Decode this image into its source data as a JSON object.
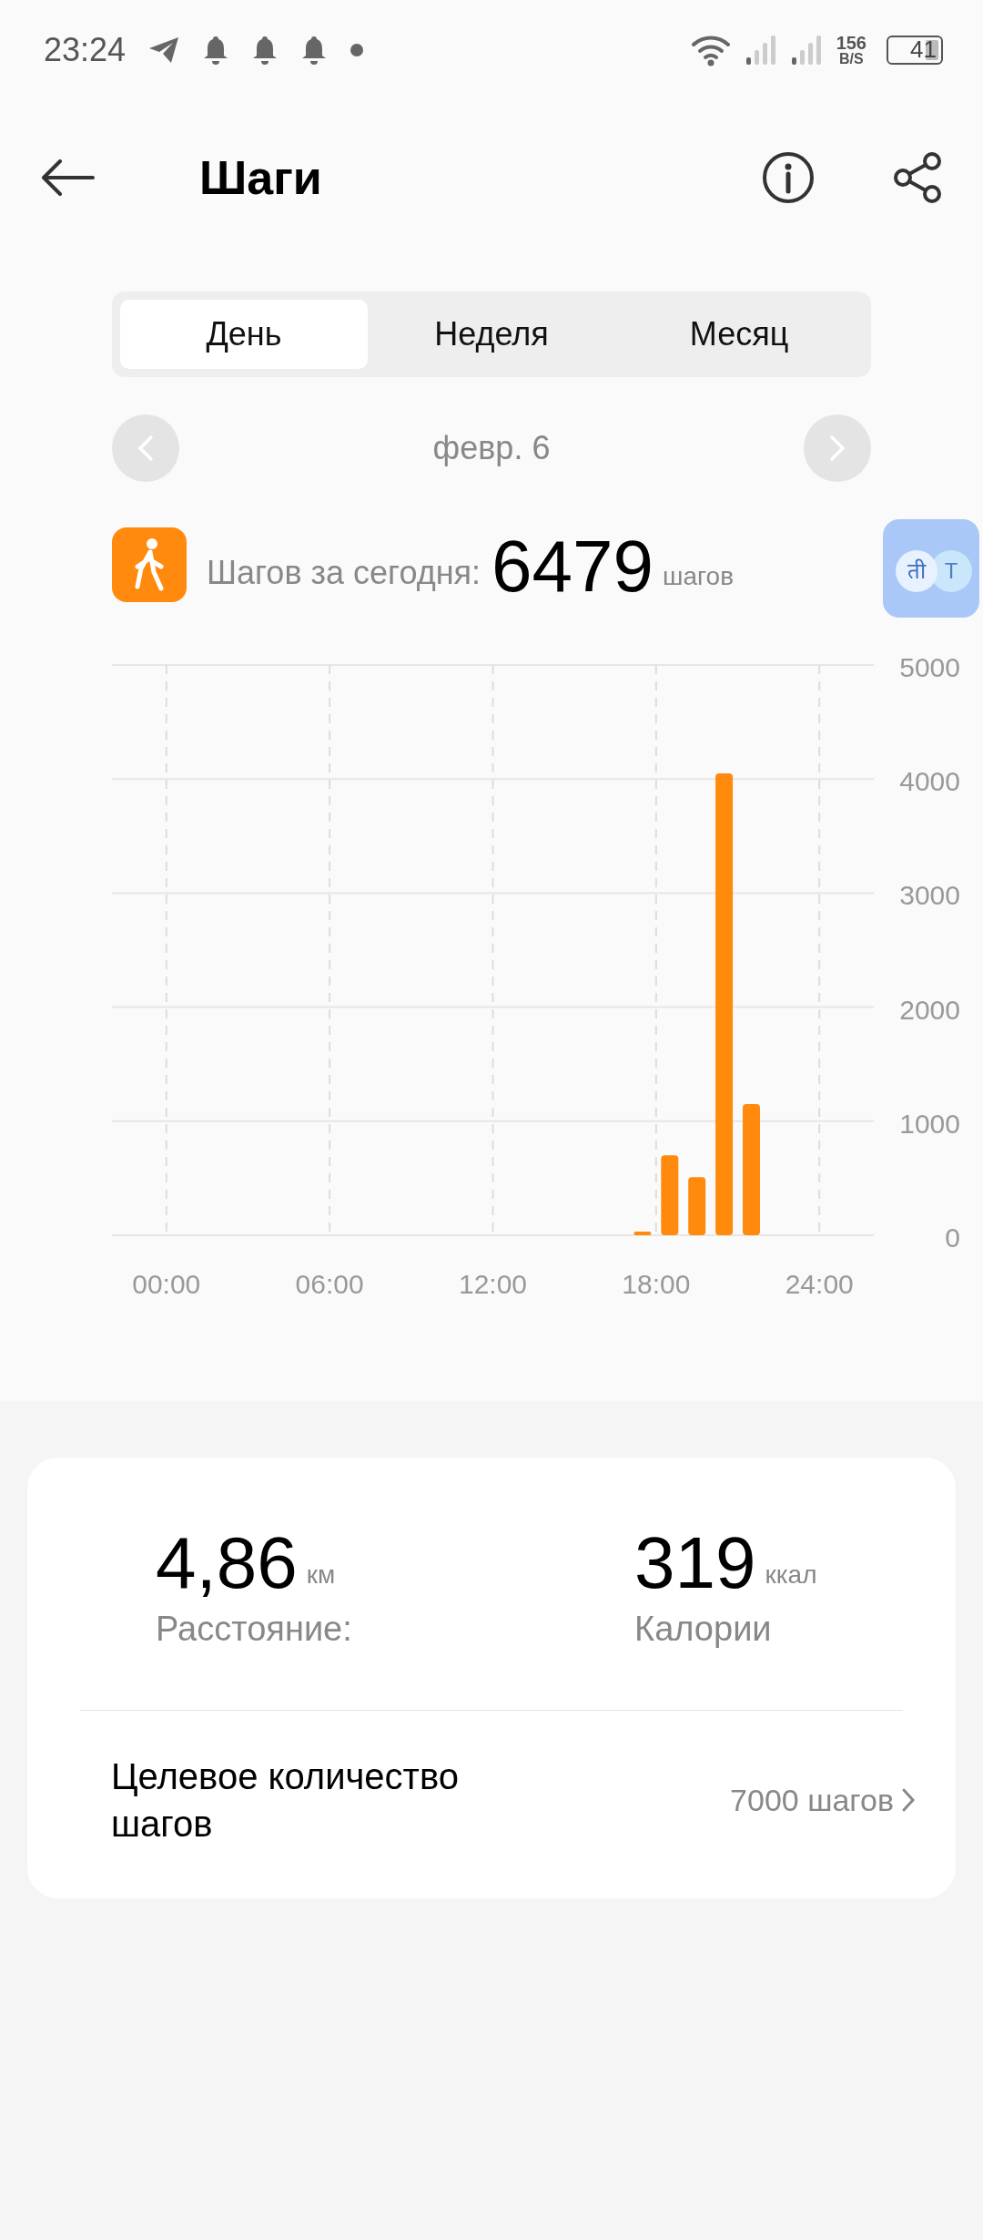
{
  "status_bar": {
    "time": "23:24",
    "net_speed": "156",
    "net_unit": "B/S",
    "battery": "41"
  },
  "header": {
    "title": "Шаги"
  },
  "tabs": [
    {
      "label": "День",
      "selected": true
    },
    {
      "label": "Неделя",
      "selected": false
    },
    {
      "label": "Месяц",
      "selected": false
    }
  ],
  "date_nav": {
    "date": "февр. 6"
  },
  "summary": {
    "label": "Шагов за сегодня:",
    "value": "6479",
    "unit": "шагов"
  },
  "translator_bubble": {
    "letters": [
      "ती",
      "T"
    ]
  },
  "chart": {
    "chart_data": {
      "type": "bar",
      "x": [
        17.5,
        18.5,
        19.5,
        20.5,
        21.5
      ],
      "series": [
        {
          "color": "#ff8a0d",
          "values": [
            20,
            700,
            510,
            4050,
            1150
          ]
        }
      ],
      "xlim": [
        -2,
        26
      ],
      "ylim": [
        0,
        5000
      ],
      "grid": true,
      "yticks": [
        0,
        1000,
        2000,
        3000,
        4000,
        5000
      ],
      "xticks": [
        {
          "value": 0,
          "label": "00:00"
        },
        {
          "value": 6,
          "label": "06:00"
        },
        {
          "value": 12,
          "label": "12:00"
        },
        {
          "value": 18,
          "label": "18:00"
        },
        {
          "value": 24,
          "label": "24:00"
        }
      ]
    }
  },
  "stats": [
    {
      "value": "4,86",
      "unit": "км",
      "label": "Расстояние:"
    },
    {
      "value": "319",
      "unit": "ккал",
      "label": "Калории"
    }
  ],
  "goal": {
    "label": "Целевое количество шагов",
    "value": "7000 шагов"
  }
}
